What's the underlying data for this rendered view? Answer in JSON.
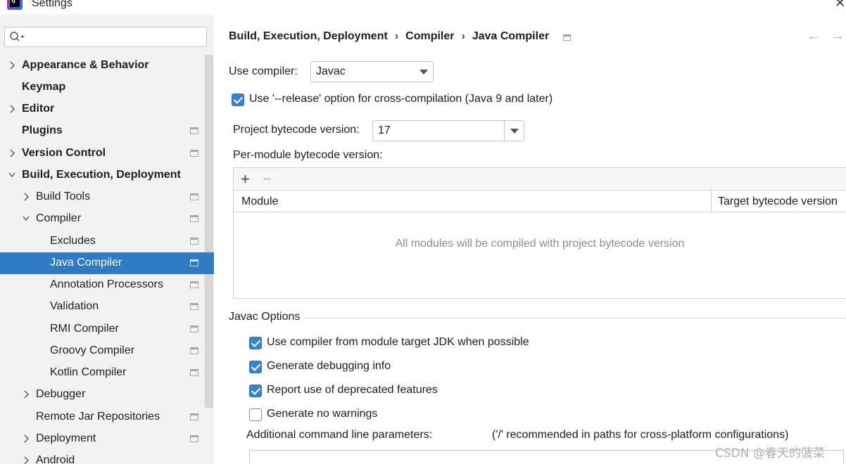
{
  "window": {
    "title": "Settings",
    "close_icon": "close-icon",
    "logo_letters": "IJ"
  },
  "search": {
    "placeholder": "",
    "value": ""
  },
  "sidebar": {
    "items": [
      {
        "label": "Appearance & Behavior",
        "bold": true,
        "arrow": "right",
        "icon": false
      },
      {
        "label": "Keymap",
        "bold": true,
        "arrow": "none",
        "icon": false
      },
      {
        "label": "Editor",
        "bold": true,
        "arrow": "right",
        "icon": false
      },
      {
        "label": "Plugins",
        "bold": true,
        "arrow": "none",
        "icon": true
      },
      {
        "label": "Version Control",
        "bold": true,
        "arrow": "right",
        "icon": true
      },
      {
        "label": "Build, Execution, Deployment",
        "bold": true,
        "arrow": "down",
        "icon": false
      },
      {
        "label": "Build Tools",
        "bold": false,
        "arrow": "right",
        "icon": true
      },
      {
        "label": "Compiler",
        "bold": false,
        "arrow": "down",
        "icon": true
      },
      {
        "label": "Excludes",
        "bold": false,
        "arrow": "none",
        "icon": true
      },
      {
        "label": "Java Compiler",
        "bold": false,
        "arrow": "none",
        "icon": true,
        "selected": true
      },
      {
        "label": "Annotation Processors",
        "bold": false,
        "arrow": "none",
        "icon": true
      },
      {
        "label": "Validation",
        "bold": false,
        "arrow": "none",
        "icon": true
      },
      {
        "label": "RMI Compiler",
        "bold": false,
        "arrow": "none",
        "icon": true
      },
      {
        "label": "Groovy Compiler",
        "bold": false,
        "arrow": "none",
        "icon": true
      },
      {
        "label": "Kotlin Compiler",
        "bold": false,
        "arrow": "none",
        "icon": true
      },
      {
        "label": "Debugger",
        "bold": false,
        "arrow": "right",
        "icon": false
      },
      {
        "label": "Remote Jar Repositories",
        "bold": false,
        "arrow": "none",
        "icon": true
      },
      {
        "label": "Deployment",
        "bold": false,
        "arrow": "right",
        "icon": true
      },
      {
        "label": "Android",
        "bold": false,
        "arrow": "right",
        "icon": false
      }
    ]
  },
  "breadcrumb": {
    "parts": [
      "Build, Execution, Deployment",
      "Compiler",
      "Java Compiler"
    ],
    "separator": "›"
  },
  "nav": {
    "back": "←",
    "forward": "→"
  },
  "compiler": {
    "use_compiler_label": "Use compiler:",
    "use_compiler_value": "Javac",
    "release_option_label": "Use '--release' option for cross-compilation (Java 9 and later)",
    "release_option_checked": true,
    "project_bytecode_label": "Project bytecode version:",
    "project_bytecode_value": "17",
    "per_module_label": "Per-module bytecode version:"
  },
  "module_table": {
    "add_label": "+",
    "remove_label": "−",
    "columns": [
      "Module",
      "Target bytecode version"
    ],
    "empty_text": "All modules will be compiled with project bytecode version"
  },
  "javac_options": {
    "title": "Javac Options",
    "checkboxes": [
      {
        "label": "Use compiler from module target JDK when possible",
        "checked": true
      },
      {
        "label": "Generate debugging info",
        "checked": true
      },
      {
        "label": "Report use of deprecated features",
        "checked": true
      },
      {
        "label": "Generate no warnings",
        "checked": false
      }
    ],
    "additional_params_label": "Additional command line parameters:",
    "additional_params_hint": "('/' recommended in paths for cross-platform configurations)"
  },
  "watermark": "CSDN @春天的菠菜",
  "colors": {
    "selection": "#2f7bc6",
    "checkbox": "#3b82d6",
    "sidebar_bg": "#f2f2f2"
  }
}
